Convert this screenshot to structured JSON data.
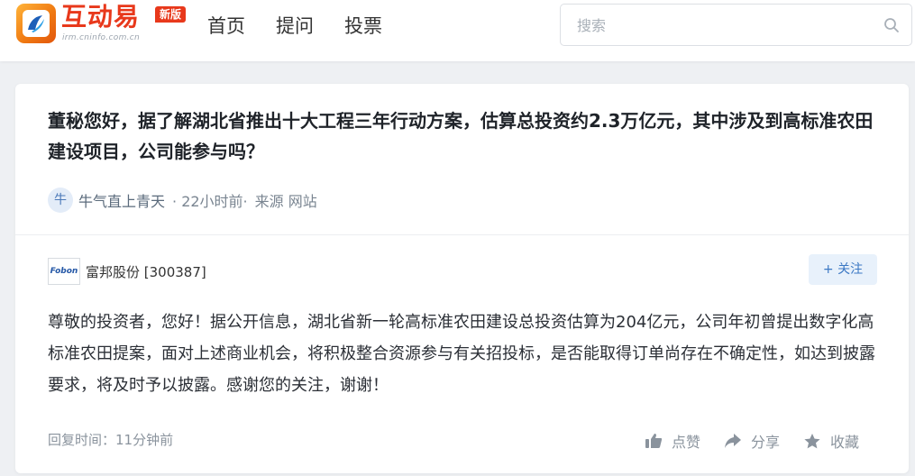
{
  "header": {
    "logo_text": "互动易",
    "logo_sub": "irm.cninfo.com.cn",
    "logo_badge": "新版",
    "nav": [
      "首页",
      "提问",
      "投票"
    ],
    "search_placeholder": "搜索"
  },
  "question": {
    "text": "董秘您好，据了解湖北省推出十大工程三年行动方案，估算总投资约2.3万亿元，其中涉及到高标准农田建设项目，公司能参与吗？",
    "avatar_char": "牛",
    "asker_name": "牛气直上青天",
    "time": "· 22小时前·",
    "source": "来源 网站"
  },
  "answer": {
    "company_logo": "Fobon",
    "company_name": "富邦股份 [300387]",
    "follow_label": "+ 关注",
    "text": "尊敬的投资者，您好！据公开信息，湖北省新一轮高标准农田建设总投资估算为204亿元，公司年初曾提出数字化高标准农田提案，面对上述商业机会，将积极整合资源参与有关招投标，是否能取得订单尚存在不确定性，如达到披露要求，将及时予以披露。感谢您的关注，谢谢！",
    "reply_time": "回复时间：11分钟前",
    "actions": {
      "like": "点赞",
      "share": "分享",
      "favorite": "收藏"
    }
  },
  "colors": {
    "brand_red": "#e8381b",
    "brand_orange": "#f07a12",
    "follow_blue": "#3b78c4",
    "background": "#eef0f3"
  },
  "icons": [
    "logo-icon",
    "search-icon",
    "thumbs-up-icon",
    "share-arrow-icon",
    "star-icon"
  ]
}
